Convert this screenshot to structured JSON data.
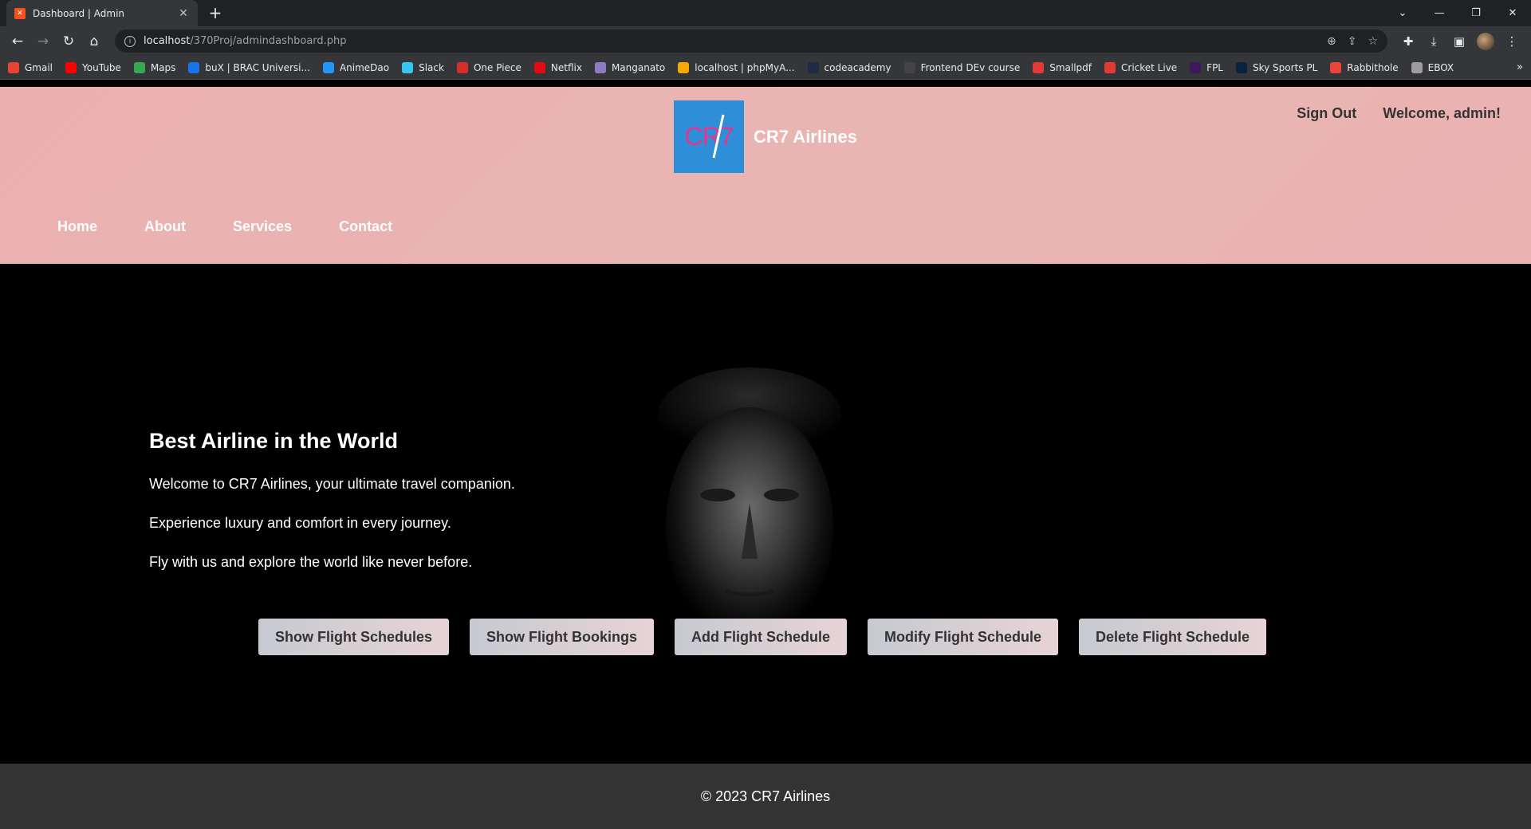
{
  "browser": {
    "tab_title": "Dashboard | Admin",
    "url_host": "localhost",
    "url_path": "/370Proj/admindashboard.php",
    "bookmarks": [
      {
        "label": "Gmail",
        "color": "#ea4335"
      },
      {
        "label": "YouTube",
        "color": "#ff0000"
      },
      {
        "label": "Maps",
        "color": "#34a853"
      },
      {
        "label": "buX | BRAC Universi...",
        "color": "#1a73e8"
      },
      {
        "label": "AnimeDao",
        "color": "#2196f3"
      },
      {
        "label": "Slack",
        "color": "#36c5f0"
      },
      {
        "label": "One Piece",
        "color": "#d32f2f"
      },
      {
        "label": "Netflix",
        "color": "#e50914"
      },
      {
        "label": "Manganato",
        "color": "#8e7cc3"
      },
      {
        "label": "localhost | phpMyA...",
        "color": "#f6a800"
      },
      {
        "label": "codeacademy",
        "color": "#1f2a44"
      },
      {
        "label": "Frontend DEv course",
        "color": "#444"
      },
      {
        "label": "Smallpdf",
        "color": "#e53935"
      },
      {
        "label": "Cricket Live",
        "color": "#e53935"
      },
      {
        "label": "FPL",
        "color": "#3d195b"
      },
      {
        "label": "Sky Sports PL",
        "color": "#0a2240"
      },
      {
        "label": "Rabbithole",
        "color": "#e8443a"
      },
      {
        "label": "EBOX",
        "color": "#9e9e9e"
      }
    ]
  },
  "header": {
    "brand": "CR7 Airlines",
    "logo_text": "CR7",
    "sign_out": "Sign Out",
    "welcome": "Welcome, admin!",
    "nav": [
      "Home",
      "About",
      "Services",
      "Contact"
    ]
  },
  "hero": {
    "title": "Best Airline in the World",
    "lines": [
      "Welcome to CR7 Airlines, your ultimate travel companion.",
      "Experience luxury and comfort in every journey.",
      "Fly with us and explore the world like never before."
    ],
    "buttons": [
      "Show Flight Schedules",
      "Show Flight Bookings",
      "Add Flight Schedule",
      "Modify Flight Schedule",
      "Delete Flight Schedule"
    ]
  },
  "footer": {
    "text": "© 2023 CR7 Airlines"
  }
}
